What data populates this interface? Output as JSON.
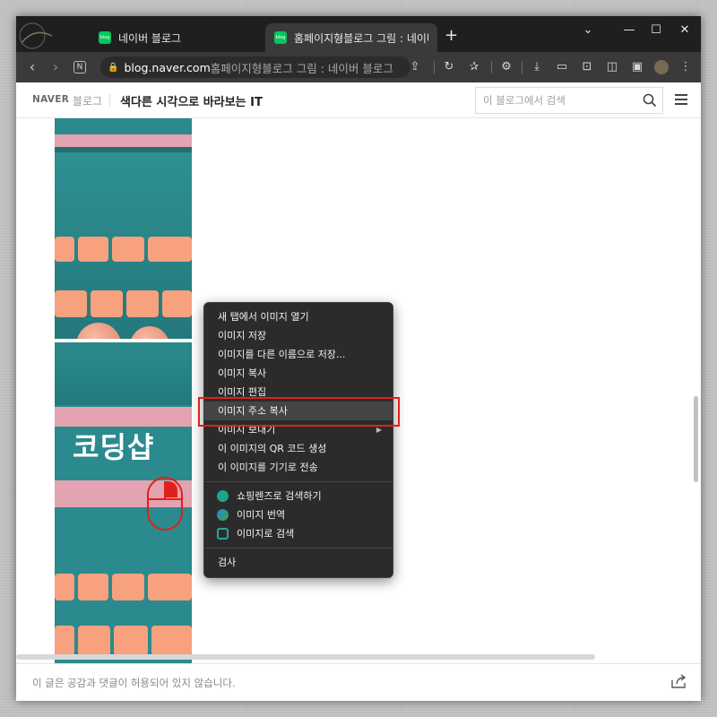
{
  "browser": {
    "tabs": [
      {
        "title": "네이버 블로그",
        "favicon": "blog",
        "active": false
      },
      {
        "title": "홈페이지형블로그 그림 : 네이버",
        "favicon": "blog",
        "active": true
      }
    ],
    "new_tab_icon": "plus-icon",
    "window_controls": [
      "chevron-down-icon",
      "minimize-icon",
      "maximize-icon",
      "close-icon"
    ],
    "address": {
      "domain": "blog.naver.com",
      "rest": " 홈페이지형블로그 그림 : 네이버 블로그"
    },
    "toolbar_icons": [
      "back-icon",
      "forward-icon",
      "reader-icon",
      "share-icon",
      "reload-icon",
      "favorite-add-icon",
      "extensions-icon",
      "download-icon",
      "video-icon",
      "screenshot-icon",
      "split-screen-icon",
      "sidebar-icon",
      "profile-icon",
      "more-icon"
    ]
  },
  "blog": {
    "brand": "NAVER",
    "brand_sub": "블로그",
    "title": "색다른 시각으로 바라보는 IT",
    "search_placeholder": "이 블로그에서 검색",
    "image_text": "코딩샵"
  },
  "context_menu": {
    "group1": [
      {
        "label": "새 탭에서 이미지 열기"
      },
      {
        "label": "이미지 저장"
      },
      {
        "label": "이미지를 다른 이름으로 저장..."
      },
      {
        "label": "이미지 복사"
      },
      {
        "label": "이미지 편집"
      },
      {
        "label": "이미지 주소 복사",
        "highlighted": true
      },
      {
        "label": "이미지 보내기",
        "submenu": true
      },
      {
        "label": "이 이미지의 QR 코드 생성"
      },
      {
        "label": "이 이미지를 기기로 전송"
      }
    ],
    "group2": [
      {
        "label": "쇼핑렌즈로 검색하기",
        "icon": "shopping-lens-icon"
      },
      {
        "label": "이미지 번역",
        "icon": "translate-icon"
      },
      {
        "label": "이미지로 검색",
        "icon": "image-search-icon"
      }
    ],
    "group3": [
      {
        "label": "검사"
      }
    ]
  },
  "footer": {
    "notice": "이 글은 공감과 댓글이 허용되어 있지 않습니다."
  },
  "colors": {
    "highlight_box": "#e0201a",
    "teal": "#2b8a8d",
    "pink": "#e3a3b0",
    "key": "#f7a17e"
  }
}
